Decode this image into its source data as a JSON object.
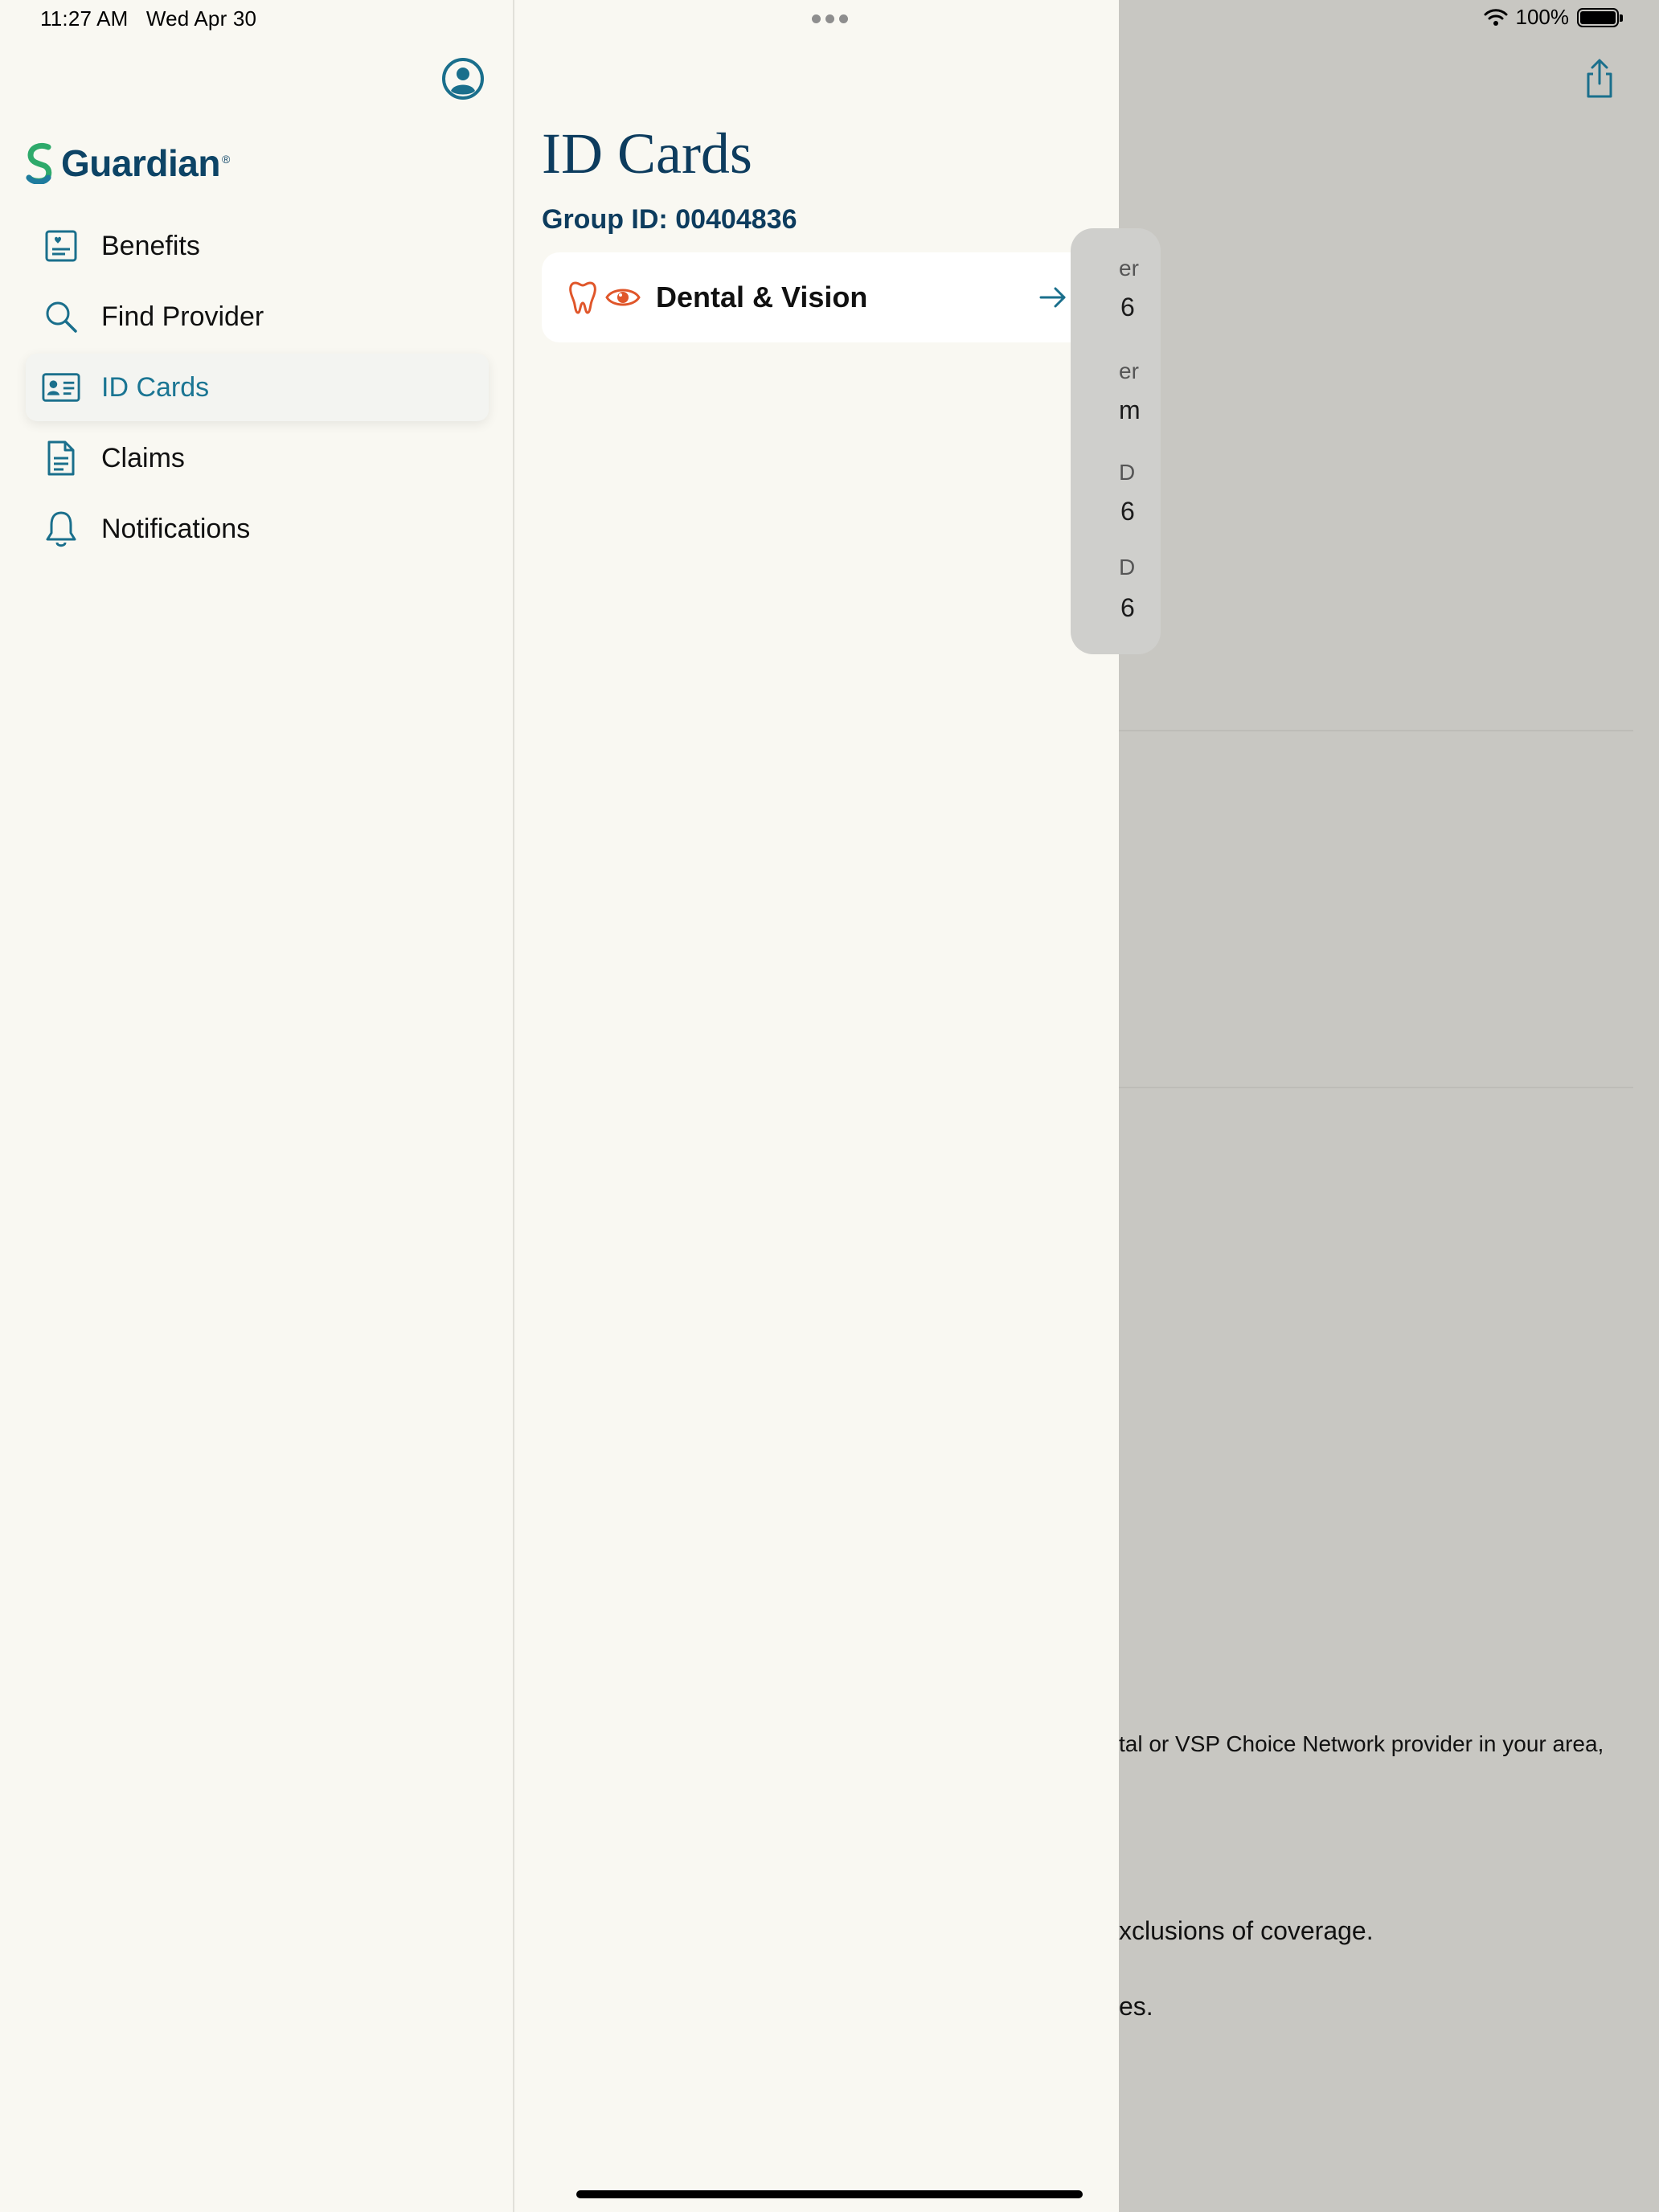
{
  "status_bar": {
    "time": "11:27 AM",
    "date": "Wed Apr 30",
    "battery": "100%"
  },
  "sidebar": {
    "logo_text": "Guardian",
    "logo_trademark": "®",
    "items": [
      {
        "label": "Benefits",
        "icon": "benefits-icon",
        "active": false
      },
      {
        "label": "Find Provider",
        "icon": "search-icon",
        "active": false
      },
      {
        "label": "ID Cards",
        "icon": "id-card-icon",
        "active": true
      },
      {
        "label": "Claims",
        "icon": "document-icon",
        "active": false
      },
      {
        "label": "Notifications",
        "icon": "bell-icon",
        "active": false
      }
    ]
  },
  "main": {
    "title": "ID Cards",
    "group_id": "Group ID: 00404836",
    "cards": [
      {
        "label": "Dental & Vision",
        "icons": [
          "tooth-icon",
          "eye-icon"
        ]
      }
    ]
  },
  "background": {
    "fragments": {
      "f1_label": "er",
      "f1_value": "6",
      "f2_label": "er",
      "f2_value": "m",
      "f3_label": "D",
      "f3_value": "6",
      "f4_label": "D",
      "f4_value": "6",
      "line1": "tal or VSP Choice Network provider in your area,",
      "line2": "xclusions of coverage.",
      "line3": "es."
    }
  },
  "colors": {
    "brand_navy": "#0d3c5e",
    "accent_teal": "#1a7593",
    "icon_orange": "#e0562a",
    "logo_green": "#2eaa6b",
    "background": "#f9f8f2",
    "dim_overlay": "#c8c7c2"
  }
}
